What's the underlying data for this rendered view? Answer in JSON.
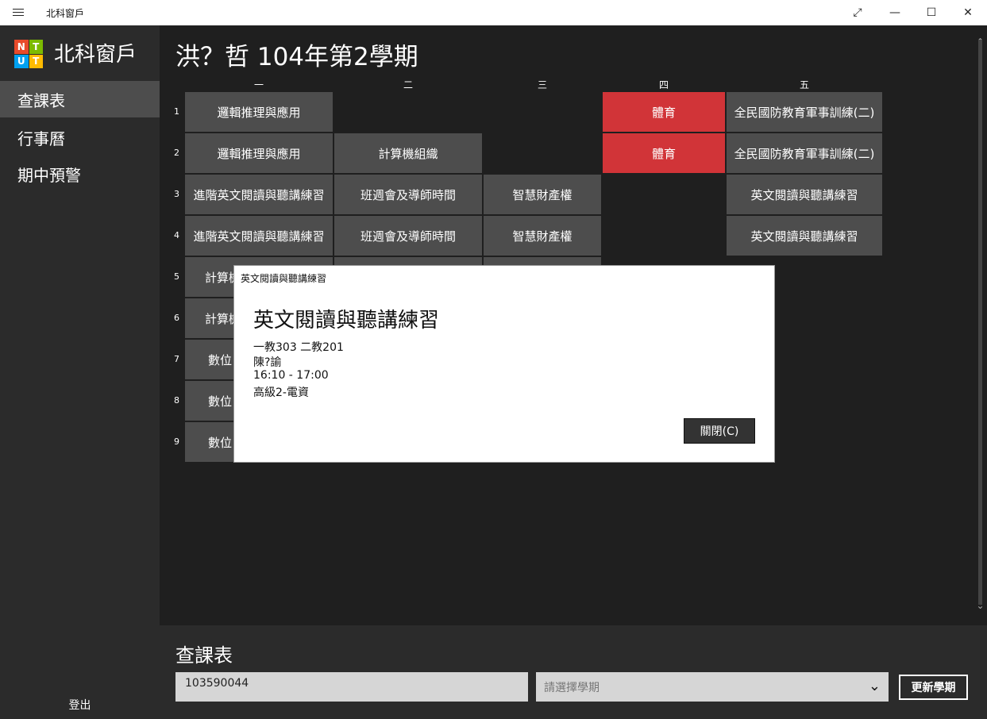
{
  "window": {
    "title": "北科窗戶"
  },
  "sidebar": {
    "brand": "北科窗戶",
    "logo_letters": [
      "N",
      "T",
      "U",
      "T"
    ],
    "logo_colors": [
      "#e84a2a",
      "#7cbb00",
      "#00a1f1",
      "#ffbb00"
    ],
    "items": [
      {
        "label": "查課表",
        "active": true
      },
      {
        "label": "行事曆",
        "active": false
      },
      {
        "label": "期中預警",
        "active": false
      }
    ],
    "logout": "登出"
  },
  "schedule": {
    "title": "洪？哲 104年第2學期",
    "days": [
      "一",
      "二",
      "三",
      "四",
      "五"
    ],
    "periods": [
      "1",
      "2",
      "3",
      "4",
      "5",
      "6",
      "7",
      "8",
      "9"
    ],
    "courses": {
      "mon": [
        "邏輯推理與應用",
        "邏輯推理與應用",
        "進階英文閱讀與聽講練習",
        "進階英文閱讀與聽講練習",
        "計算機",
        "計算機",
        "數位",
        "數位",
        "數位"
      ],
      "tue": [
        "",
        "計算機組織",
        "班週會及導師時間",
        "班週會及導師時間"
      ],
      "wed": [
        "",
        "",
        "智慧財產權",
        "智慧財產權"
      ],
      "thu": [
        "體育",
        "體育"
      ],
      "fri": [
        "全民國防教育軍事訓練(二)",
        "全民國防教育軍事訓練(二)",
        "英文閱讀與聽講練習",
        "英文閱讀與聽講練習"
      ]
    },
    "highlight_color": "#d13438"
  },
  "bottom": {
    "title": "查課表",
    "student_id": "103590044",
    "semester_placeholder": "請選擇學期",
    "update_button": "更新學期"
  },
  "dialog": {
    "caption": "英文閱讀與聽講練習",
    "title": "英文閱讀與聽講練習",
    "room": "一教303 二教201",
    "teacher": "陳?諭",
    "time": "16:10 - 17:00",
    "class": "高級2-電資",
    "close_button": "關閉(C)"
  }
}
